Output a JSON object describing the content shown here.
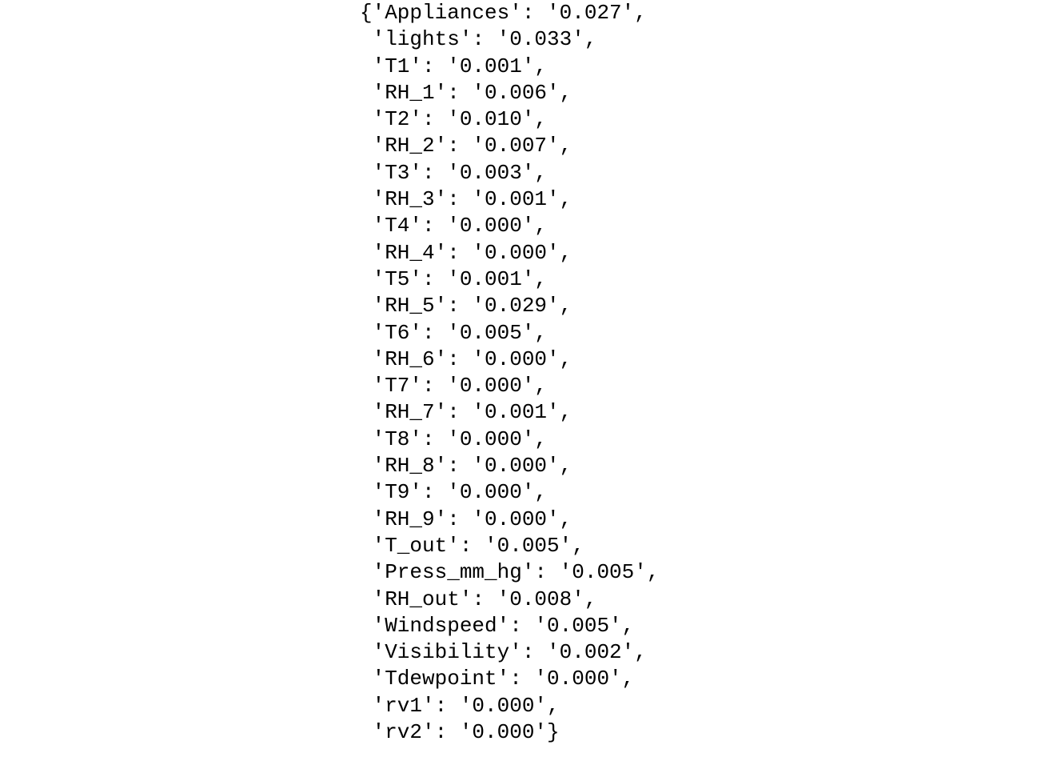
{
  "dict": {
    "entries": [
      {
        "key": "Appliances",
        "value": "0.027"
      },
      {
        "key": "lights",
        "value": "0.033"
      },
      {
        "key": "T1",
        "value": "0.001"
      },
      {
        "key": "RH_1",
        "value": "0.006"
      },
      {
        "key": "T2",
        "value": "0.010"
      },
      {
        "key": "RH_2",
        "value": "0.007"
      },
      {
        "key": "T3",
        "value": "0.003"
      },
      {
        "key": "RH_3",
        "value": "0.001"
      },
      {
        "key": "T4",
        "value": "0.000"
      },
      {
        "key": "RH_4",
        "value": "0.000"
      },
      {
        "key": "T5",
        "value": "0.001"
      },
      {
        "key": "RH_5",
        "value": "0.029"
      },
      {
        "key": "T6",
        "value": "0.005"
      },
      {
        "key": "RH_6",
        "value": "0.000"
      },
      {
        "key": "T7",
        "value": "0.000"
      },
      {
        "key": "RH_7",
        "value": "0.001"
      },
      {
        "key": "T8",
        "value": "0.000"
      },
      {
        "key": "RH_8",
        "value": "0.000"
      },
      {
        "key": "T9",
        "value": "0.000"
      },
      {
        "key": "RH_9",
        "value": "0.000"
      },
      {
        "key": "T_out",
        "value": "0.005"
      },
      {
        "key": "Press_mm_hg",
        "value": "0.005"
      },
      {
        "key": "RH_out",
        "value": "0.008"
      },
      {
        "key": "Windspeed",
        "value": "0.005"
      },
      {
        "key": "Visibility",
        "value": "0.002"
      },
      {
        "key": "Tdewpoint",
        "value": "0.000"
      },
      {
        "key": "rv1",
        "value": "0.000"
      },
      {
        "key": "rv2",
        "value": "0.000"
      }
    ]
  }
}
